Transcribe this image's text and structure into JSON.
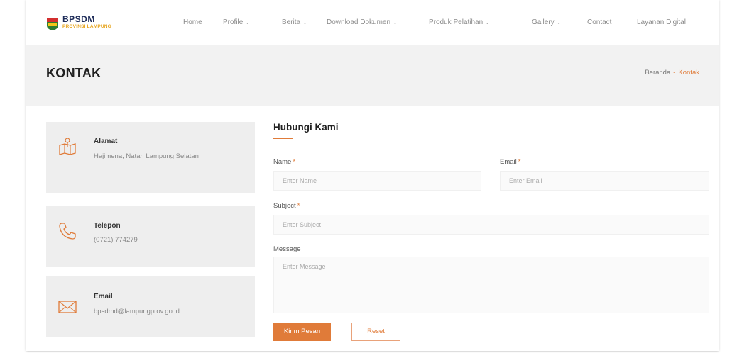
{
  "brand": {
    "title": "BPSDM",
    "subtitle": "PROVINSI LAMPUNG"
  },
  "nav": {
    "home": "Home",
    "profile": "Profile",
    "berita": "Berita",
    "download": "Download Dokumen",
    "produk": "Produk Pelatihan",
    "gallery": "Gallery",
    "contact": "Contact",
    "layanan": "Layanan Digital"
  },
  "page": {
    "title": "KONTAK"
  },
  "breadcrumb": {
    "home": "Beranda",
    "separator": "-",
    "current": "Kontak"
  },
  "cards": {
    "alamat": {
      "icon": "map-icon",
      "title": "Alamat",
      "text": "Hajimena, Natar, Lampung Selatan"
    },
    "telepon": {
      "icon": "phone-icon",
      "title": "Telepon",
      "text": "(0721) 774279"
    },
    "email": {
      "icon": "mail-icon",
      "title": "Email",
      "text": "bpsdmd@lampungprov.go.id"
    }
  },
  "form": {
    "title": "Hubungi Kami",
    "name_label": "Name",
    "name_placeholder": "Enter Name",
    "email_label": "Email",
    "email_placeholder": "Enter Email",
    "subject_label": "Subject",
    "subject_placeholder": "Enter Subject",
    "message_label": "Message",
    "message_placeholder": "Enter Message",
    "required_mark": "*",
    "submit_label": "Kirim Pesan",
    "reset_label": "Reset"
  },
  "colors": {
    "accent": "#e07b39",
    "band": "#f2f2f2",
    "card": "#eeeeee"
  }
}
